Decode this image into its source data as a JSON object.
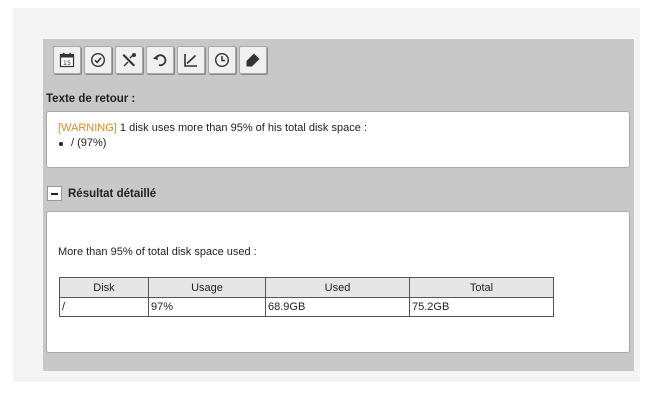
{
  "toolbar": {
    "buttons": [
      {
        "icon": "calendar-icon",
        "text": "15"
      },
      {
        "icon": "check-circle-icon"
      },
      {
        "icon": "tools-icon"
      },
      {
        "icon": "undo-icon"
      },
      {
        "icon": "chart-icon"
      },
      {
        "icon": "clock-icon"
      },
      {
        "icon": "tag-icon"
      }
    ]
  },
  "feedback": {
    "label": "Texte de retour :",
    "warning_tag": "[WARNING]",
    "message": " 1 disk uses more than 95% of his total disk space :",
    "items": [
      "/ (97%)"
    ]
  },
  "details": {
    "title": "Résultat détaillé",
    "description": "More than 95% of total disk space used :",
    "table": {
      "headers": [
        "Disk",
        "Usage",
        "Used",
        "Total"
      ],
      "rows": [
        [
          "/",
          "97%",
          "68.9GB",
          "75.2GB"
        ]
      ]
    }
  }
}
